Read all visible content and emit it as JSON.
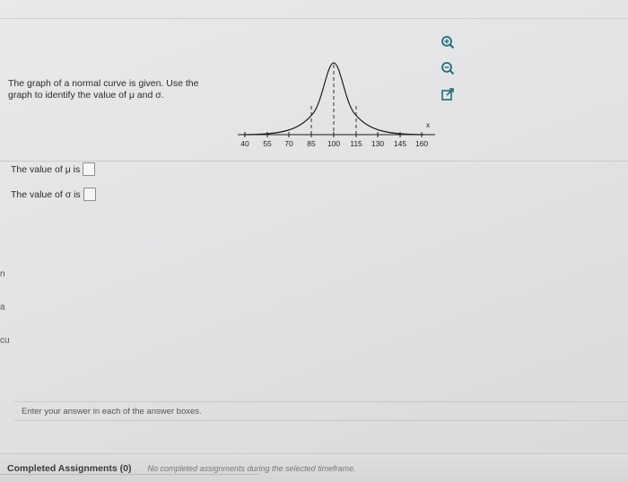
{
  "question": {
    "prompt": "The graph of a normal curve is given. Use the graph to identify the value of μ and σ.",
    "graph": {
      "x_label": "x",
      "ticks": [
        "40",
        "55",
        "70",
        "85",
        "100",
        "115",
        "130",
        "145",
        "160"
      ]
    }
  },
  "answers": {
    "mu_label": "The value of μ is",
    "sigma_label": "The value of σ is"
  },
  "tools": {
    "zoom_in": "zoom-in-icon",
    "zoom_out": "zoom-out-icon",
    "popout": "popout-icon"
  },
  "left_fragments": [
    "n",
    "a",
    "cu"
  ],
  "instruction": "Enter your answer in each of the answer boxes.",
  "footer": {
    "title": "Completed Assignments (0)",
    "note": "No completed assignments during the selected timeframe."
  },
  "colors": {
    "accent": "#1f6f7a",
    "text": "#2b2b2b"
  }
}
